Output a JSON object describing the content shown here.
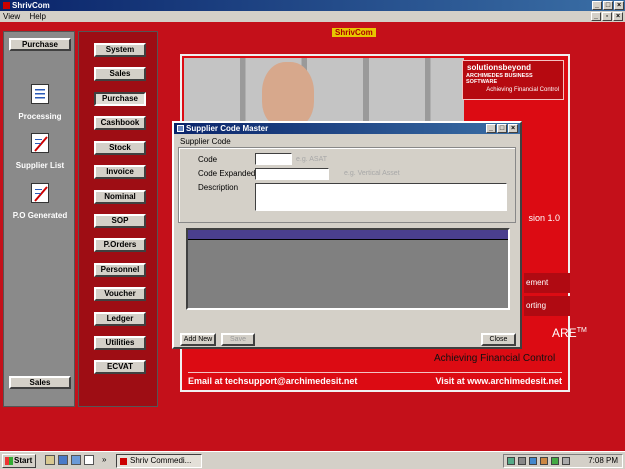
{
  "app": {
    "title": "ShrivCom"
  },
  "menubar": [
    "View",
    "Help"
  ],
  "left_panel": {
    "top_button": "Purchase",
    "items": [
      {
        "label": "Processing",
        "icon": "document-icon"
      },
      {
        "label": "Supplier List",
        "icon": "edit-document-icon"
      },
      {
        "label": "P.O Generated",
        "icon": "edit-document-icon"
      }
    ],
    "bottom_button": "Sales"
  },
  "modules": [
    "System",
    "Sales",
    "Purchase",
    "Cashbook",
    "Stock",
    "Invoice",
    "Nominal",
    "SOP",
    "P.Orders",
    "Personnel",
    "Voucher",
    "Ledger",
    "Utilities",
    "ECVAT"
  ],
  "selected_module": "Purchase",
  "splash": {
    "label": "ShrivCom",
    "logo_name": "solutionsbeyond",
    "logo_sub": "ARCHIMEDES BUSINESS SOFTWARE",
    "logo_tag": "Achieving Financial Control",
    "version_frag": "sion 1.0",
    "menu_frag_1": "ement",
    "menu_frag_2": "orting",
    "are_frag": "ARE",
    "tagline": "Achieving Financial Control",
    "email": "Email at techsupport@archimedesit.net",
    "visit": "Visit at www.archimedesit.net"
  },
  "dialog": {
    "title": "Supplier Code Master",
    "group_label": "Supplier Code",
    "fields": {
      "code": {
        "label": "Code",
        "value": "",
        "hint": "e.g. ASAT"
      },
      "code_expanded": {
        "label": "Code Expanded",
        "value": "",
        "hint": "e.g. Vertical Asset"
      },
      "description": {
        "label": "Description",
        "value": ""
      }
    },
    "buttons": {
      "add_new": "Add New",
      "save": "Save",
      "close": "Close"
    }
  },
  "taskbar": {
    "start": "Start",
    "task": "Shriv Commedi...",
    "clock": "7:08 PM",
    "chevron": "»"
  },
  "colors": {
    "workspace": "#c4101a",
    "title_gradient": "#0a246a",
    "grid_header": "#4a3f8e"
  }
}
